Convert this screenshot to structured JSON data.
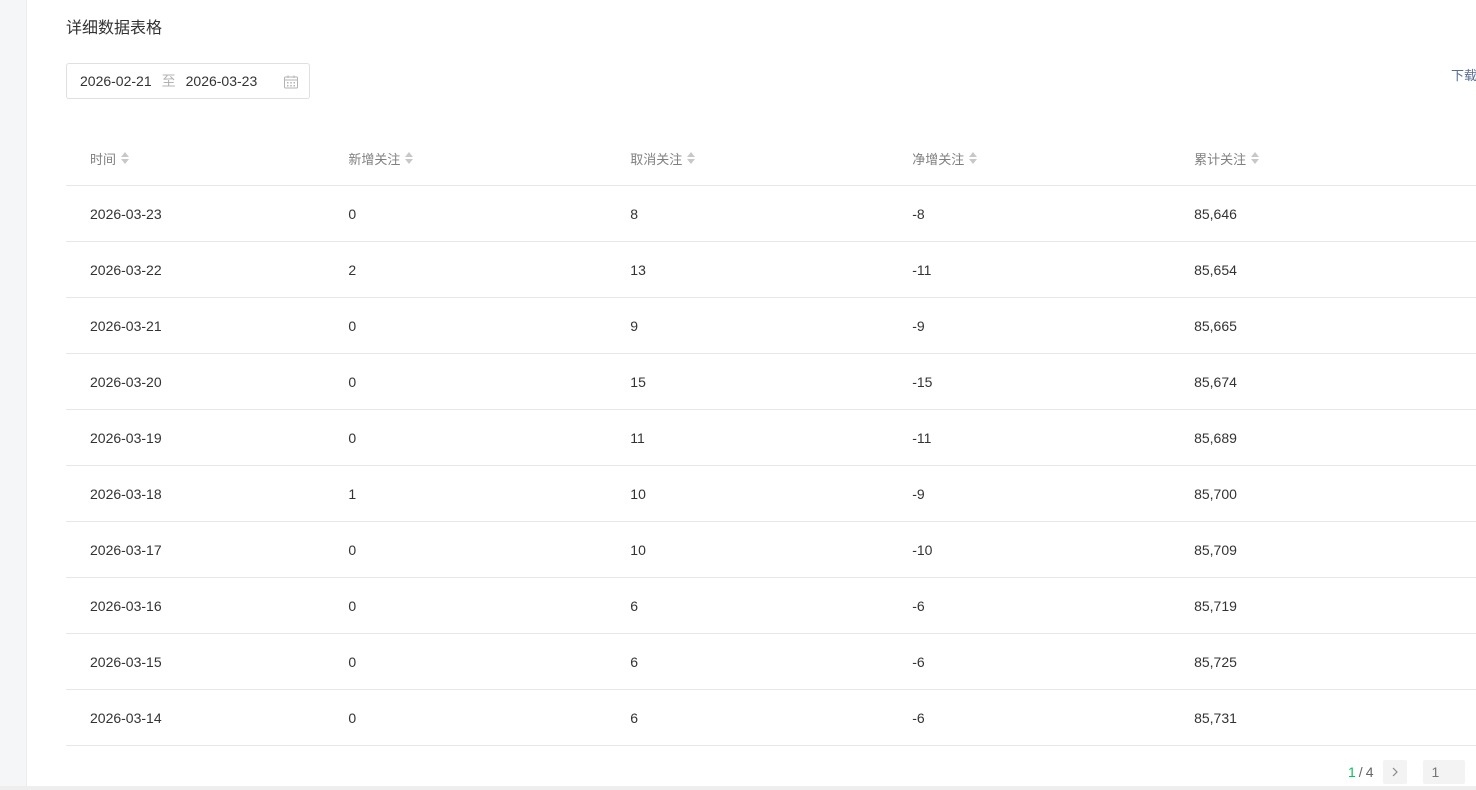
{
  "section_title": "详细数据表格",
  "date_range": {
    "start": "2026-02-21",
    "separator": "至",
    "end": "2026-03-23"
  },
  "download_label": "下载",
  "columns": [
    "时间",
    "新增关注",
    "取消关注",
    "净增关注",
    "累计关注"
  ],
  "rows": [
    [
      "2026-03-23",
      "0",
      "8",
      "-8",
      "85,646"
    ],
    [
      "2026-03-22",
      "2",
      "13",
      "-11",
      "85,654"
    ],
    [
      "2026-03-21",
      "0",
      "9",
      "-9",
      "85,665"
    ],
    [
      "2026-03-20",
      "0",
      "15",
      "-15",
      "85,674"
    ],
    [
      "2026-03-19",
      "0",
      "11",
      "-11",
      "85,689"
    ],
    [
      "2026-03-18",
      "1",
      "10",
      "-9",
      "85,700"
    ],
    [
      "2026-03-17",
      "0",
      "10",
      "-10",
      "85,709"
    ],
    [
      "2026-03-16",
      "0",
      "6",
      "-6",
      "85,719"
    ],
    [
      "2026-03-15",
      "0",
      "6",
      "-6",
      "85,725"
    ],
    [
      "2026-03-14",
      "0",
      "6",
      "-6",
      "85,731"
    ]
  ],
  "pagination": {
    "current": "1",
    "separator": "/",
    "total": "4",
    "input_placeholder": "1"
  },
  "colors": {
    "accent_green": "#07c160",
    "link_blue": "#576b95"
  },
  "icons": {
    "calendar": "calendar-icon",
    "sort": "sort-icon",
    "next": "chevron-right-icon"
  }
}
